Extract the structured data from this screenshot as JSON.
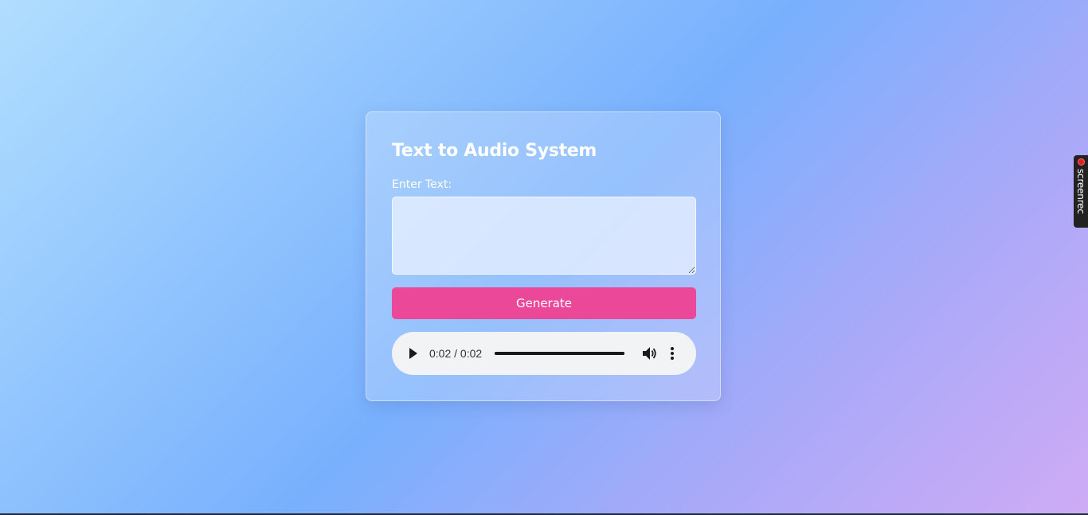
{
  "app": {
    "title": "Text to Audio System",
    "input_label": "Enter Text:",
    "input_value": "",
    "generate_label": "Generate"
  },
  "player": {
    "time": "0:02 / 0:02",
    "progress_fraction": 1.0
  },
  "overlay": {
    "screenrec_label": "screenrec"
  },
  "icons": {
    "play": "play-icon",
    "volume": "volume-icon",
    "more": "more-vertical-icon",
    "record": "record-dot-icon"
  },
  "colors": {
    "accent": "#ec4899",
    "player_bg": "#f1f3f4"
  }
}
